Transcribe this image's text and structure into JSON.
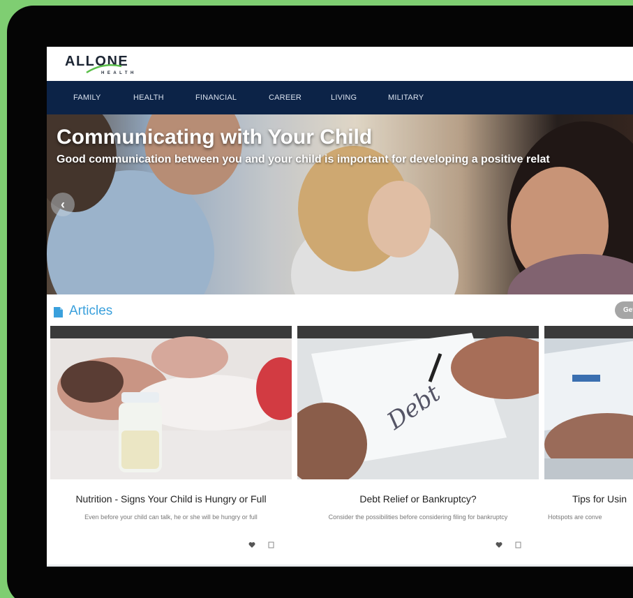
{
  "colors": {
    "background": "#7fce72",
    "bezel": "#050505",
    "nav": "#0c2347",
    "accent": "#3aa0dc",
    "logo_green": "#5bbf4a"
  },
  "logo": {
    "main": "ALLONE",
    "sub": "HEALTH"
  },
  "nav": {
    "items": [
      "FAMILY",
      "HEALTH",
      "FINANCIAL",
      "CAREER",
      "LIVING",
      "MILITARY"
    ]
  },
  "hero": {
    "title": "Communicating with Your Child",
    "subtitle": "Good communication between you and your child is important for developing a positive relat",
    "prev_label": "‹"
  },
  "articles": {
    "heading": "Articles",
    "heading_icon": "document-icon",
    "get_button": "Get I",
    "cards": [
      {
        "title": "Nutrition - Signs Your Child is Hungry or Full",
        "description": "Even before your child can talk, he or she will be hungry or full",
        "image": "baby-bottle-photo"
      },
      {
        "title": "Debt Relief or Bankruptcy?",
        "description": "Consider the possibilities before considering filing for bankruptcy",
        "image": "debt-check-photo"
      },
      {
        "title": "Tips for Usin",
        "description": "Hotspots are conve",
        "image": "laptop-photo"
      }
    ],
    "card_icons": [
      "heart-icon",
      "bookmark-icon"
    ]
  }
}
